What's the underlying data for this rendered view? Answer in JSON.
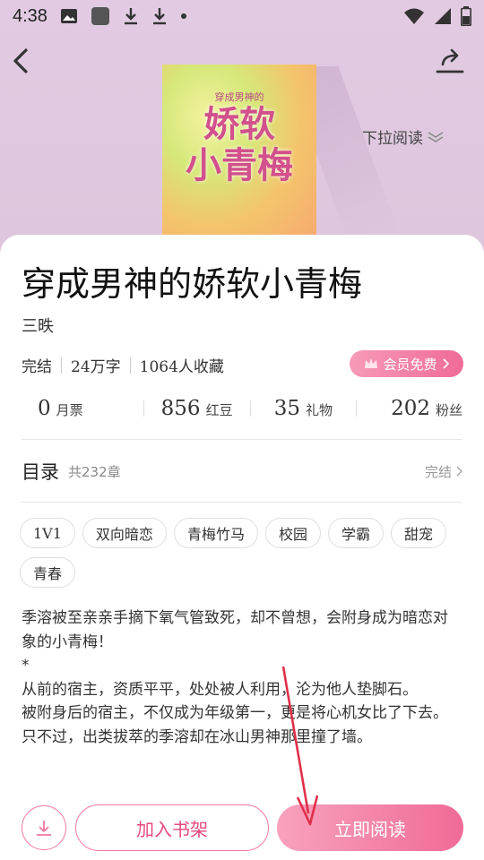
{
  "status_bar": {
    "time": "4:38",
    "left_icons": [
      "image-icon",
      "app-square-icon",
      "download-icon",
      "download-icon",
      "dot-icon"
    ],
    "right_icons": [
      "wifi-icon",
      "signal-icon",
      "battery-icon"
    ]
  },
  "nav": {
    "back_icon": "chevron-left-icon",
    "share_icon": "share-icon",
    "pull_hint": "下拉阅读"
  },
  "cover": {
    "subtitle": "穿成男神的",
    "title_line1": "娇软",
    "title_line2": "小青梅"
  },
  "book": {
    "title": "穿成男神的娇软小青梅",
    "author": "三昳",
    "status": "完结",
    "word_count": "24万字",
    "collections": "1064人收藏",
    "vip_badge": "会员免费"
  },
  "stats": [
    {
      "value": "0",
      "label": "月票"
    },
    {
      "value": "856",
      "label": "红豆"
    },
    {
      "value": "35",
      "label": "礼物"
    },
    {
      "value": "202",
      "label": "粉丝"
    }
  ],
  "toc": {
    "title": "目录",
    "count": "共232章",
    "status": "完结"
  },
  "tags": [
    "1V1",
    "双向暗恋",
    "青梅竹马",
    "校园",
    "学霸",
    "甜宠",
    "青春"
  ],
  "summary": [
    "季溶被至亲亲手摘下氧气管致死，却不曾想，会附身成为暗恋对象的小青梅！",
    "*",
    "从前的宿主，资质平平，处处被人利用，沦为他人垫脚石。",
    "被附身后的宿主，不仅成为年级第一，更是将心机女比了下去。",
    "只不过，出类拔萃的季溶却在冰山男神那里撞了墙。"
  ],
  "actions": {
    "download_icon": "download-icon",
    "add_to_shelf": "加入书架",
    "read_now": "立即阅读"
  },
  "colors": {
    "accent": "#f06b97",
    "header_bg": "#dcc8dc",
    "annotation": "#e0304a"
  }
}
